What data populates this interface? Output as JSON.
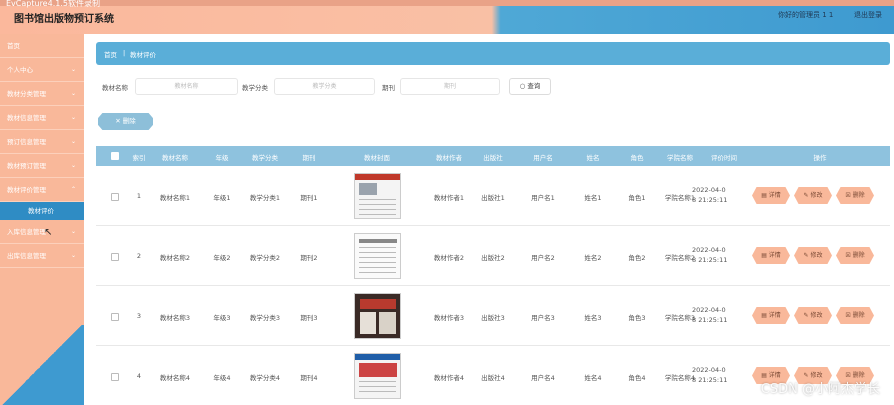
{
  "header": {
    "app_title": "EvCapture4.1.5软件录制",
    "system_title": "图书馆出版物预订系统",
    "user_text": "你好的管理员 1 1",
    "logout_label": "退出登录"
  },
  "sidebar": {
    "items": [
      {
        "label": "首页"
      },
      {
        "label": "个人中心"
      },
      {
        "label": "教材分类管理"
      },
      {
        "label": "教材信息管理"
      },
      {
        "label": "预订信息管理"
      },
      {
        "label": "教材预订管理"
      },
      {
        "label": "教材评价管理"
      }
    ],
    "active_sub": "教材评价",
    "items_after": [
      {
        "label": "入库信息管理"
      },
      {
        "label": "出库信息管理"
      }
    ],
    "chevron": "chevron-down-icon"
  },
  "breadcrumb": {
    "home": "首页",
    "current": "教材评价"
  },
  "search": {
    "fields": [
      {
        "label": "教材名称",
        "placeholder": "教材名称"
      },
      {
        "label": "教学分类",
        "placeholder": "教学分类"
      },
      {
        "label": "期刊",
        "placeholder": "期刊"
      }
    ],
    "button_label": "查询"
  },
  "delete_button_label": "删除",
  "table": {
    "headers": [
      "索引",
      "教材名称",
      "年级",
      "教学分类",
      "期刊",
      "教材封面",
      "教材作者",
      "出版社",
      "用户名",
      "姓名",
      "角色",
      "学院名称",
      "评价时间",
      "操作"
    ],
    "rows": [
      {
        "idx": "1",
        "name": "教材名称1",
        "grade": "年级1",
        "category": "教学分类1",
        "journal": "期刊1",
        "author": "教材作者1",
        "publisher": "出版社1",
        "username": "用户名1",
        "realname": "姓名1",
        "role": "角色1",
        "college": "学院名称1",
        "time1": "2022-04-0",
        "time2": "8 21:25:11"
      },
      {
        "idx": "2",
        "name": "教材名称2",
        "grade": "年级2",
        "category": "教学分类2",
        "journal": "期刊2",
        "author": "教材作者2",
        "publisher": "出版社2",
        "username": "用户名2",
        "realname": "姓名2",
        "role": "角色2",
        "college": "学院名称2",
        "time1": "2022-04-0",
        "time2": "8 21:25:11"
      },
      {
        "idx": "3",
        "name": "教材名称3",
        "grade": "年级3",
        "category": "教学分类3",
        "journal": "期刊3",
        "author": "教材作者3",
        "publisher": "出版社3",
        "username": "用户名3",
        "realname": "姓名3",
        "role": "角色3",
        "college": "学院名称3",
        "time1": "2022-04-0",
        "time2": "8 21:25:11"
      },
      {
        "idx": "4",
        "name": "教材名称4",
        "grade": "年级4",
        "category": "教学分类4",
        "journal": "期刊4",
        "author": "教材作者4",
        "publisher": "出版社4",
        "username": "用户名4",
        "realname": "姓名4",
        "role": "角色4",
        "college": "学院名称4",
        "time1": "2022-04-0",
        "time2": "8 21:25:11"
      }
    ],
    "actions": {
      "detail": "详情",
      "edit": "修改",
      "delete": "删除"
    }
  },
  "watermark": "CSDN @小阿杰学长",
  "colors": {
    "accent_peach": "#f9b89a",
    "accent_blue": "#3e9ad0",
    "table_header": "#8ec2de"
  }
}
